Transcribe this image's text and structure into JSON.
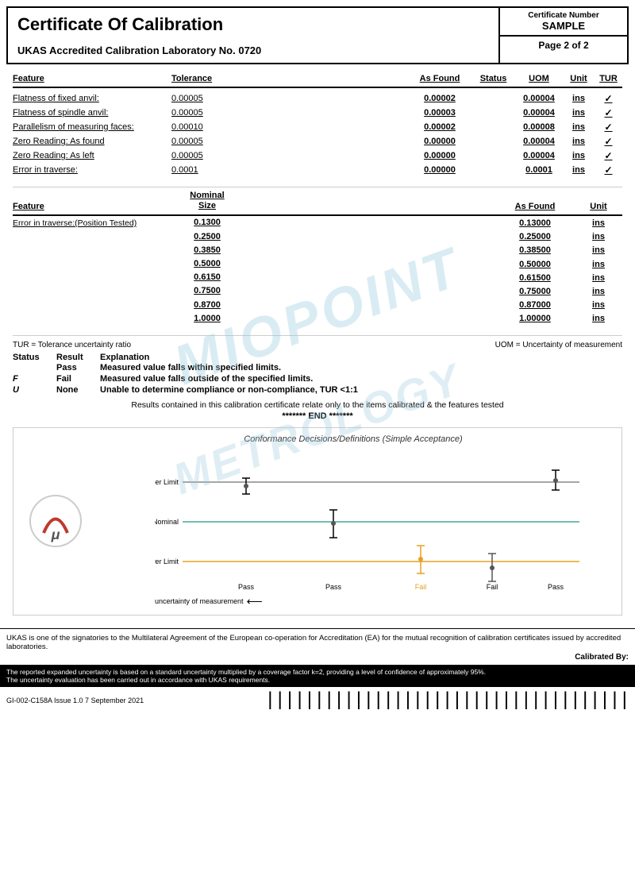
{
  "header": {
    "title": "Certificate Of Calibration",
    "subtitle": "UKAS Accredited Calibration Laboratory No. 0720",
    "cert_number_label": "Certificate Number",
    "cert_number_value": "SAMPLE",
    "page_label": "Page 2 of 2"
  },
  "section1": {
    "columns": {
      "feature": "Feature",
      "tolerance": "Tolerance",
      "as_found": "As Found",
      "status": "Status",
      "uom": "UOM",
      "unit": "Unit",
      "tur": "TUR"
    },
    "rows": [
      {
        "feature": "Flatness of fixed anvil:",
        "tolerance": "0.00005",
        "as_found": "0.00002",
        "status": "",
        "uom": "0.00004",
        "unit": "ins",
        "tur": "✓"
      },
      {
        "feature": "Flatness of spindle anvil:",
        "tolerance": "0.00005",
        "as_found": "0.00003",
        "status": "",
        "uom": "0.00004",
        "unit": "ins",
        "tur": "✓"
      },
      {
        "feature": "Parallelism of measuring faces:",
        "tolerance": "0.00010",
        "as_found": "0.00002",
        "status": "",
        "uom": "0.00008",
        "unit": "ins",
        "tur": "✓"
      },
      {
        "feature": "Zero Reading: As found",
        "tolerance": "0.00005",
        "as_found": "0.00000",
        "status": "",
        "uom": "0.00004",
        "unit": "ins",
        "tur": "✓"
      },
      {
        "feature": "Zero Reading: As left",
        "tolerance": "0.00005",
        "as_found": "0.00000",
        "status": "",
        "uom": "0.00004",
        "unit": "ins",
        "tur": "✓"
      },
      {
        "feature": "Error in traverse:",
        "tolerance": "0.0001",
        "as_found": "0.00000",
        "status": "",
        "uom": "0.0001",
        "unit": "ins",
        "tur": "✓"
      }
    ]
  },
  "section2": {
    "columns": {
      "feature": "Feature",
      "nominal": "Nominal\nSize",
      "as_found": "As Found",
      "unit": "Unit"
    },
    "feature_label": "Error in traverse:(Position Tested)",
    "rows": [
      {
        "nominal": "0.1300",
        "as_found": "0.13000",
        "unit": "ins"
      },
      {
        "nominal": "0.2500",
        "as_found": "0.25000",
        "unit": "ins"
      },
      {
        "nominal": "0.3850",
        "as_found": "0.38500",
        "unit": "ins"
      },
      {
        "nominal": "0.5000",
        "as_found": "0.50000",
        "unit": "ins"
      },
      {
        "nominal": "0.6150",
        "as_found": "0.61500",
        "unit": "ins"
      },
      {
        "nominal": "0.7500",
        "as_found": "0.75000",
        "unit": "ins"
      },
      {
        "nominal": "0.8700",
        "as_found": "0.87000",
        "unit": "ins"
      },
      {
        "nominal": "1.0000",
        "as_found": "1.00000",
        "unit": "ins"
      }
    ]
  },
  "legend": {
    "tur_def": "TUR = Tolerance uncertainty ratio",
    "uom_def": "UOM = Uncertainty of measurement",
    "status_header": "Status",
    "result_header": "Result",
    "explanation_header": "Explanation",
    "rows": [
      {
        "status": "",
        "result": "Pass",
        "explanation": "Measured value falls within specified limits."
      },
      {
        "status": "F",
        "result": "Fail",
        "explanation": "Measured value falls outside of the specified limits."
      },
      {
        "status": "U",
        "result": "None",
        "explanation": "Unable to determine compliance or non-compliance, TUR <1:1"
      }
    ],
    "results_note": "Results contained in this calibration certificate relate only to the items calibrated & the features tested",
    "end_line": "******* END *******"
  },
  "chart": {
    "title": "Conformance Decisions/Definitions (Simple Acceptance)",
    "labels": {
      "upper_limit": "Upper Limit",
      "nominal": "Nominal",
      "lower_limit": "Lower Limit"
    },
    "x_labels": [
      "Pass",
      "Pass",
      "Fail",
      "Fail",
      "Pass"
    ],
    "uncertainty_label": "uncertainty of measurement"
  },
  "ukas_text": "UKAS is one of the signatories to the Multilateral Agreement of the European co-operation for Accreditation (EA) for the mutual recognition of calibration certificates issued by accredited laboratories.",
  "calibrated_by": "Calibrated By:",
  "bottom_note": "The reported expanded uncertainty is based on a standard uncertainty multiplied by a coverage factor k=2, providing a level  of confidence of approximately 95%.\nThe uncertainty evaluation has been carried out in accordance with UKAS requirements.",
  "bottom_footer": {
    "doc_ref": "GI-002-C158A Issue 1.0 7 September 2021"
  }
}
